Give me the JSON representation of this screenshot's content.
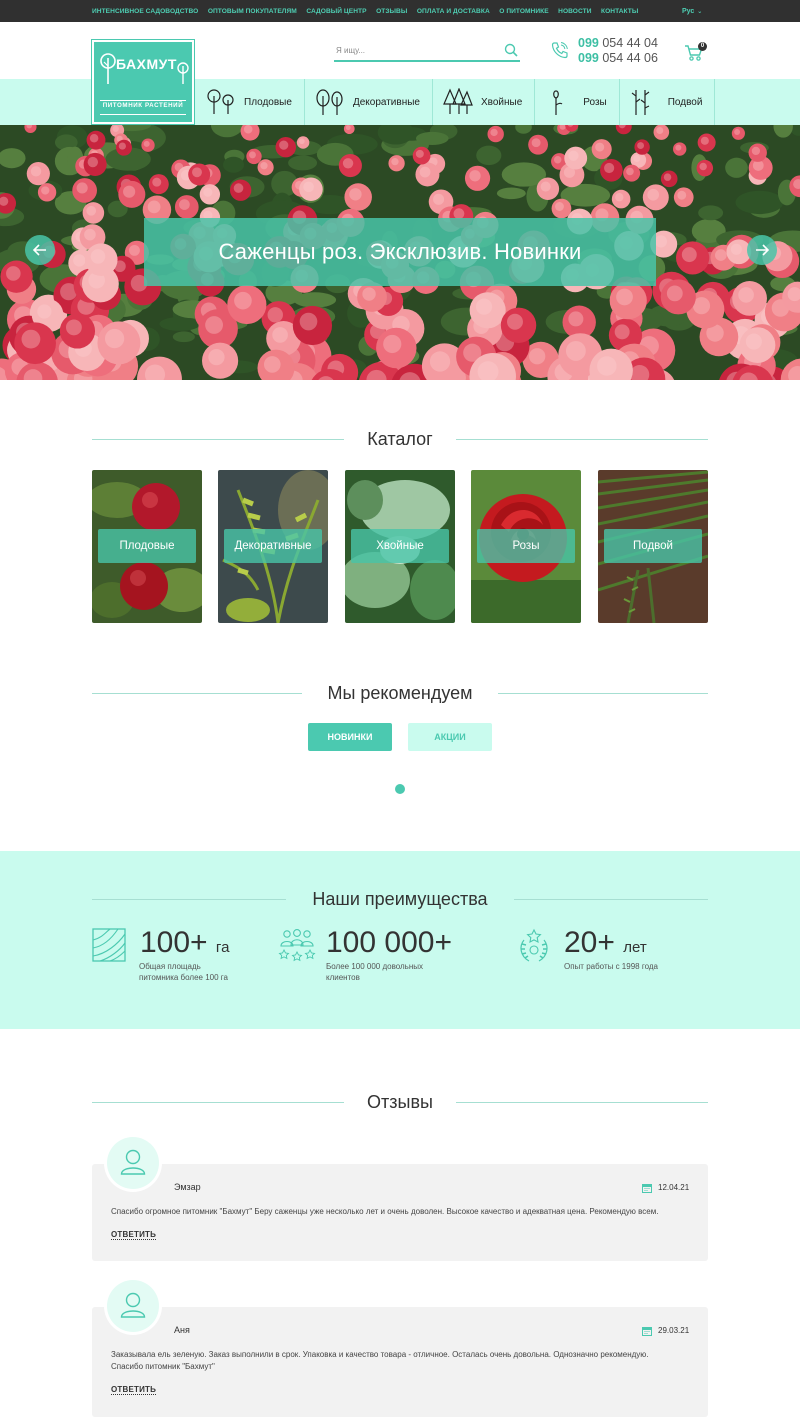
{
  "topbar": {
    "nav": [
      "Интенсивное садоводство",
      "Оптовым покупателям",
      "Садовый центр",
      "Отзывы",
      "Оплата и доставка",
      "О питомнике",
      "Новости",
      "Контакты"
    ],
    "language": "Рус"
  },
  "header": {
    "logo_name": "БАХМУТ",
    "logo_sub": "питомник растений",
    "search_placeholder": "Я ищу...",
    "phones": [
      {
        "code": "099",
        "number": "054 44 04"
      },
      {
        "code": "099",
        "number": "054 44 06"
      }
    ],
    "cart_count": "0"
  },
  "category_nav": [
    {
      "label": "Плодовые",
      "icon": "fruit-trees-icon"
    },
    {
      "label": "Декоративные",
      "icon": "decorative-trees-icon"
    },
    {
      "label": "Хвойные",
      "icon": "conifer-icon"
    },
    {
      "label": "Розы",
      "icon": "rose-icon"
    },
    {
      "label": "Подвой",
      "icon": "rootstock-icon"
    }
  ],
  "hero": {
    "banner_text": "Саженцы роз. Эксклюзив. Новинки"
  },
  "catalog": {
    "title": "Каталог",
    "items": [
      "Плодовые",
      "Декоративные",
      "Хвойные",
      "Розы",
      "Подвой"
    ]
  },
  "recommend": {
    "title": "Мы рекомендуем",
    "tabs": [
      "Новинки",
      "Акции"
    ]
  },
  "advantages": {
    "title": "Наши преимущества",
    "items": [
      {
        "value": "100+",
        "unit": "га",
        "desc1": "Общая площадь",
        "desc2": "питомника более 100 га",
        "icon": "field-icon"
      },
      {
        "value": "100 000+",
        "unit": "",
        "desc1": "Более 100 000 довольных",
        "desc2": "клиентов",
        "icon": "clients-icon"
      },
      {
        "value": "20+",
        "unit": "лет",
        "desc1": "Опыт работы с 1998 года",
        "desc2": "",
        "icon": "laurel-icon"
      }
    ]
  },
  "reviews": {
    "title": "Отзывы",
    "items": [
      {
        "name": "Эмзар",
        "date": "12.04.21",
        "text1": "Спасибо огромное питомник \"Бахмут\" Беру саженцы уже несколько лет и очень доволен. Высокое качество и адекватная цена. Рекомендую всем.",
        "text2": "",
        "reply": "Ответить"
      },
      {
        "name": "Аня",
        "date": "29.03.21",
        "text1": "Заказывала ель зеленую. Заказ выполнили в срок. Упаковка и качество товара - отличное. Осталась очень довольна. Однозначно рекомендую.",
        "text2": "Спасибо питомник \"Бахмут\"",
        "reply": "Ответить"
      }
    ]
  },
  "colors": {
    "accent": "#4bc9b0",
    "mint": "#c9fbee",
    "topbar": "#303030"
  }
}
